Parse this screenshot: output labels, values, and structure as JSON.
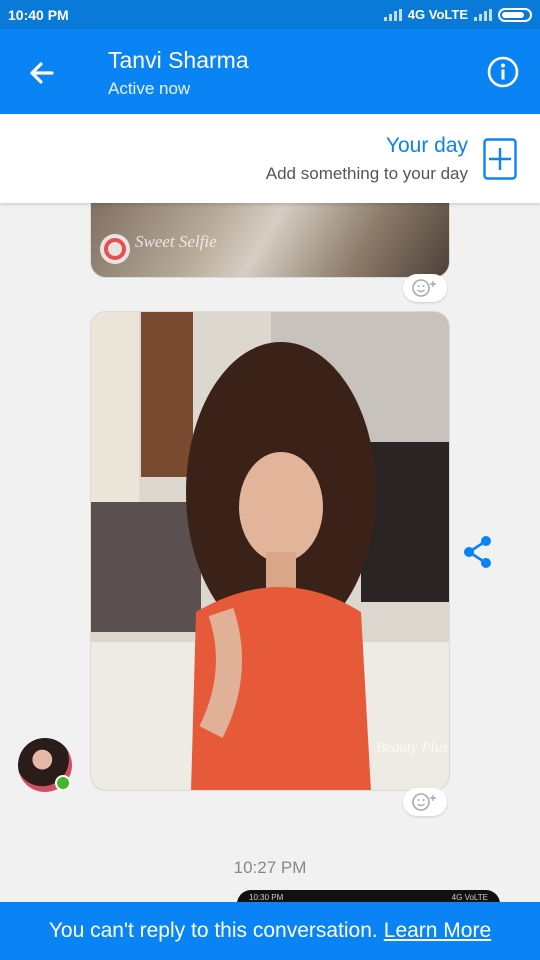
{
  "status_bar": {
    "time": "10:40 PM",
    "network": "4G VoLTE"
  },
  "header": {
    "title": "Tanvi Sharma",
    "subtitle": "Active now"
  },
  "your_day": {
    "title": "Your day",
    "subtitle": "Add something to your day"
  },
  "messages": [
    {
      "type": "photo",
      "watermark": "Sweet Selfie"
    },
    {
      "type": "photo",
      "watermark": "Beauty Plus"
    }
  ],
  "timestamp": "10:27 PM",
  "peek_status": {
    "time": "10:30 PM",
    "network": "4G VoLTE"
  },
  "footer": {
    "text": "You can't reply to this conversation.",
    "link": "Learn More"
  },
  "colors": {
    "brand": "#0a84f5",
    "online": "#42b72a"
  },
  "icons": [
    "back-arrow-icon",
    "info-icon",
    "plus-icon",
    "emoji-react-icon",
    "share-icon"
  ]
}
